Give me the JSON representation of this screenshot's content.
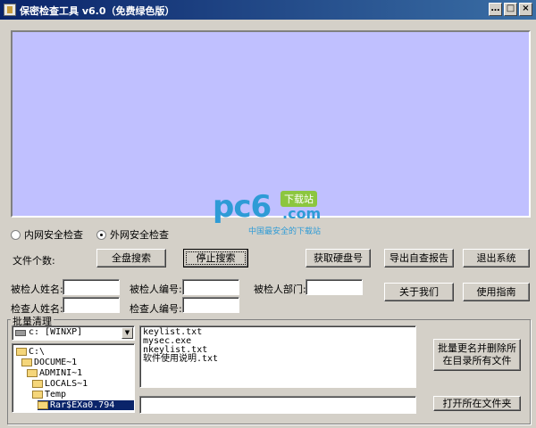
{
  "window": {
    "title": "保密检查工具 v6.0（免费绿色版）",
    "controls": [
      "…",
      "□",
      "×"
    ]
  },
  "watermark": {
    "brand": "pc6",
    "badge": "下载站",
    "domain": ".com",
    "tagline": "中国最安全的下载站"
  },
  "mode": {
    "options": [
      "内网安全检查",
      "外网安全检查"
    ],
    "selected": "外网安全检查"
  },
  "scan": {
    "file_count_label": "文件个数:",
    "full_search": "全盘搜索",
    "stop_search": "停止搜索",
    "get_disk_id": "获取硬盘号",
    "export_report": "导出自查报告",
    "exit": "退出系统"
  },
  "info": {
    "examinee_name_label": "被检人姓名:",
    "examinee_id_label": "被检人编号:",
    "examinee_dept_label": "被检人部门:",
    "inspector_name_label": "检查人姓名:",
    "inspector_id_label": "检查人编号:",
    "examinee_name": "",
    "examinee_id": "",
    "examinee_dept": "",
    "inspector_name": "",
    "inspector_id": "",
    "about": "关于我们",
    "guide": "使用指南"
  },
  "batch": {
    "group_title": "批量清理",
    "drive": "c: [WINXP]",
    "tree": [
      "C:\\",
      "DOCUME~1",
      "ADMINI~1",
      "LOCALS~1",
      "Temp",
      "Rar$EXa0.794"
    ],
    "files": [
      "keylist.txt",
      "mysec.exe",
      "nkeylist.txt",
      "软件使用说明.txt"
    ],
    "path_value": "",
    "rename_delete": "批量更名并删除所在目录所有文件",
    "open_folder": "打开所在文件夹"
  },
  "colors": {
    "titlebar_start": "#0a246a",
    "titlebar_end": "#3a6ea5",
    "panel": "#c0c0ff",
    "face": "#d4d0c8",
    "selection": "#0a246a"
  }
}
